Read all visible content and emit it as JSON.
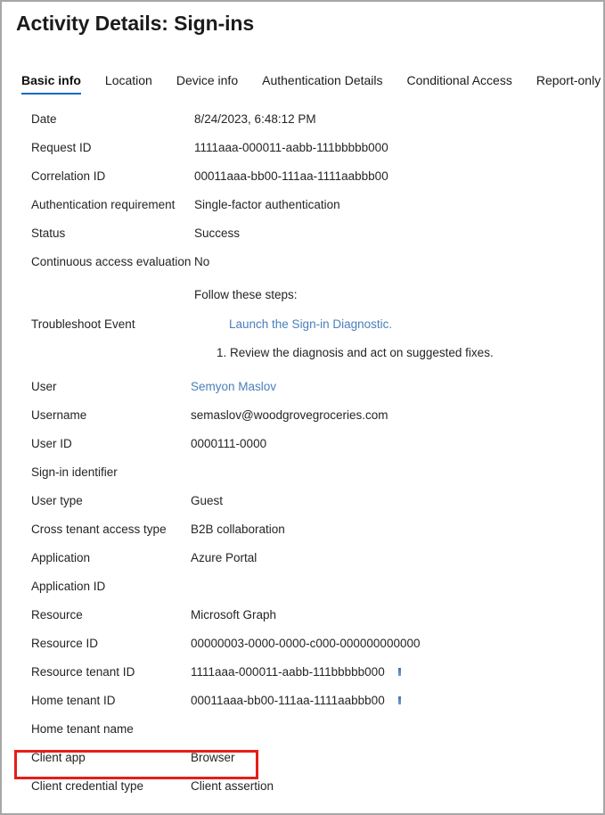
{
  "window": {
    "title": "Activity Details: Sign-ins"
  },
  "colors": {
    "accent_tab_underline": "#0d6bc4",
    "link": "#4a7ebb",
    "highlight_box": "#e61e19",
    "text": "#242424",
    "window_border": "#a6a6a6"
  },
  "tabs": [
    {
      "label": "Basic info",
      "active": true
    },
    {
      "label": "Location",
      "active": false
    },
    {
      "label": "Device info",
      "active": false
    },
    {
      "label": "Authentication Details",
      "active": false
    },
    {
      "label": "Conditional Access",
      "active": false
    },
    {
      "label": "Report-only",
      "active": false
    }
  ],
  "details": {
    "group_top": [
      {
        "label": "Date",
        "value": "8/24/2023, 6:48:12 PM"
      },
      {
        "label": "Request ID",
        "value": "1111aaa-000011-aabb-111bbbbb000"
      },
      {
        "label": "Correlation ID",
        "value": "00011aaa-bb00-111aa-1111aabbb00"
      },
      {
        "label": "Authentication requirement",
        "value": "Single-factor authentication"
      },
      {
        "label": "Status",
        "value": "Success"
      },
      {
        "label": "Continuous access evaluation",
        "value": "No"
      }
    ],
    "troubleshoot": {
      "label": "Troubleshoot Event",
      "lead": "Follow these steps:",
      "link": "Launch the Sign-in Diagnostic.",
      "step": "1. Review the diagnosis and act on suggested fixes."
    },
    "group_user": [
      {
        "label": "User",
        "value": "Semyon Maslov",
        "link": true
      },
      {
        "label": "Username",
        "value": "semaslov@woodgrovegroceries.com"
      },
      {
        "label": "User ID",
        "value": "0000111-0000"
      },
      {
        "label": "Sign-in identifier",
        "value": ""
      },
      {
        "label": "User type",
        "value": "Guest"
      },
      {
        "label": "Cross tenant access type",
        "value": "B2B collaboration"
      },
      {
        "label": "Application",
        "value": "Azure Portal"
      },
      {
        "label": "Application ID",
        "value": ""
      },
      {
        "label": "Resource",
        "value": "Microsoft Graph"
      },
      {
        "label": "Resource ID",
        "value": "00000003-0000-0000-c000-000000000000"
      },
      {
        "label": "Resource tenant ID",
        "value": "1111aaa-000011-aabb-111bbbbb000",
        "copy": true
      },
      {
        "label": "Home tenant ID",
        "value": "00011aaa-bb00-111aa-1111aabbb00",
        "copy": true
      },
      {
        "label": "Home tenant name",
        "value": ""
      },
      {
        "label": "Client app",
        "value": "Browser",
        "highlighted": true
      },
      {
        "label": "Client credential type",
        "value": "Client assertion"
      }
    ]
  }
}
